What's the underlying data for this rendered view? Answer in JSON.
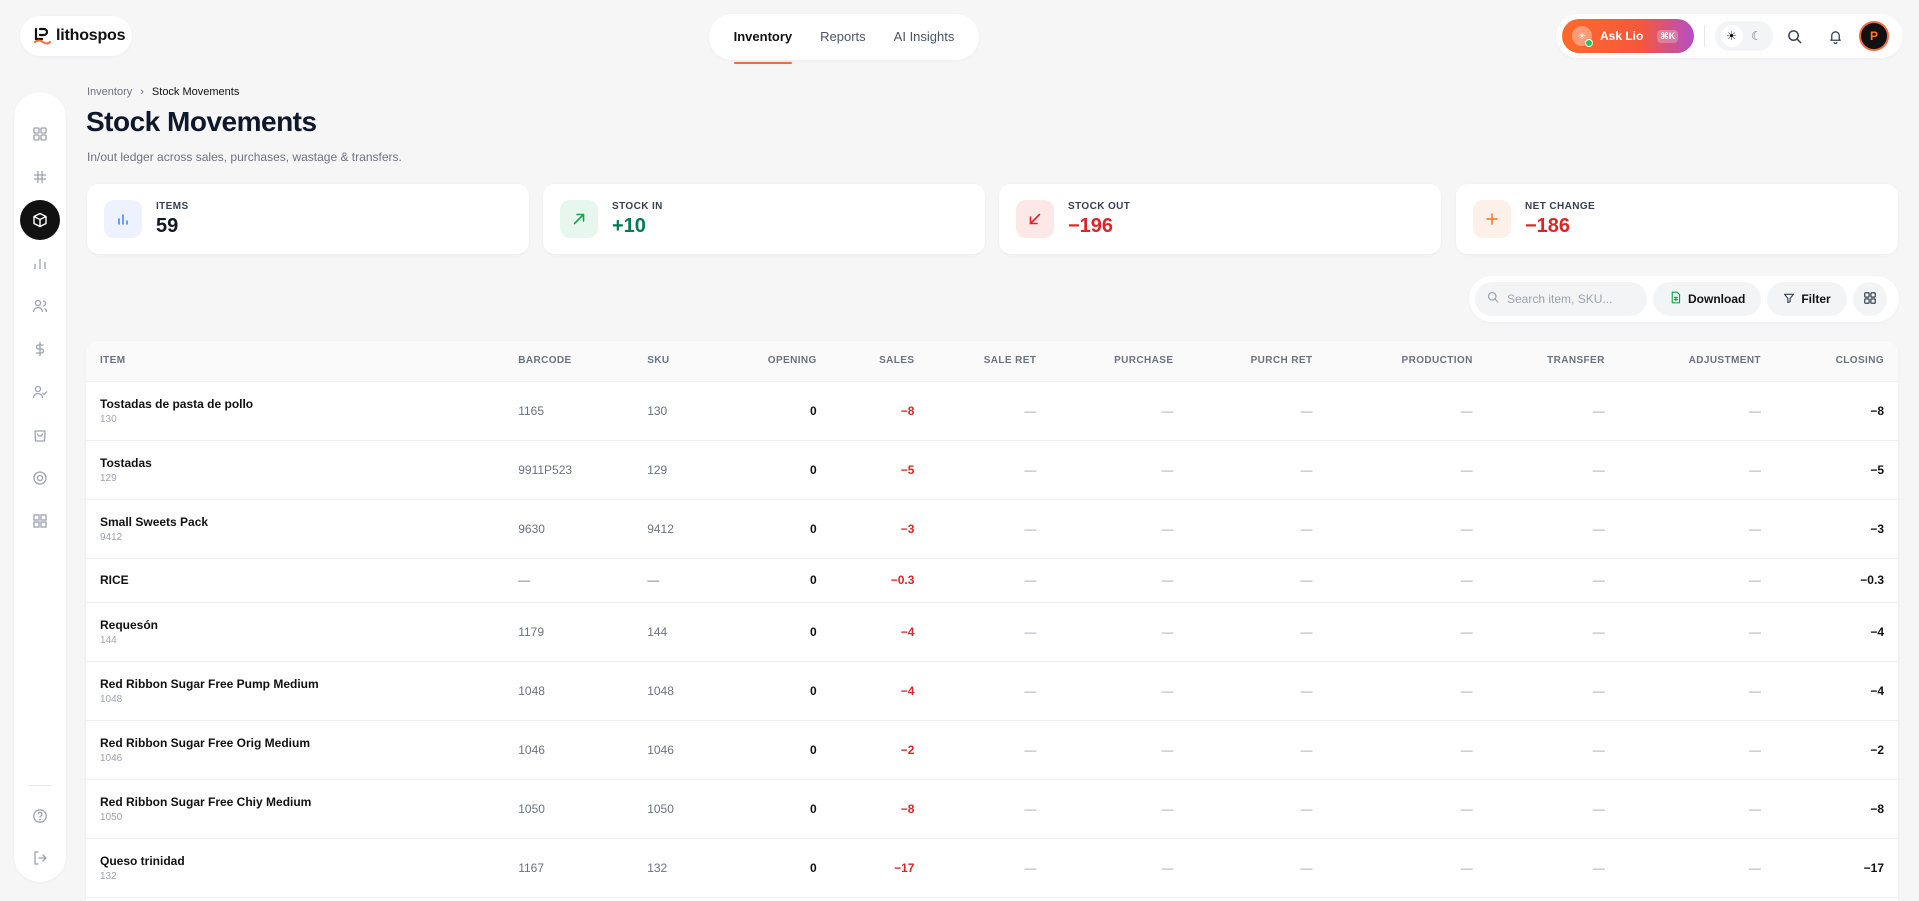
{
  "brand": {
    "name": "lithospos"
  },
  "nav": {
    "tabs": [
      "Inventory",
      "Reports",
      "AI Insights"
    ],
    "active": "Inventory"
  },
  "header": {
    "ask_label": "Ask Lio",
    "ask_shortcut": "⌘K",
    "avatar_initial": "P"
  },
  "breadcrumb": {
    "parent": "Inventory",
    "separator": "›",
    "current": "Stock Movements"
  },
  "page": {
    "title": "Stock Movements",
    "subtitle": "In/out ledger across sales, purchases, wastage & transfers."
  },
  "stats": [
    {
      "label": "ITEMS",
      "value": "59",
      "color": "#111827",
      "icon_bg": "#eef2ff",
      "icon_color": "#3b82f6",
      "icon": "bar-chart-icon"
    },
    {
      "label": "STOCK IN",
      "value": "+10",
      "color": "#047857",
      "icon_bg": "#e7f7ee",
      "icon_color": "#16a34a",
      "icon": "arrow-up-right-icon"
    },
    {
      "label": "STOCK OUT",
      "value": "−196",
      "color": "#dc2626",
      "icon_bg": "#fde8e8",
      "icon_color": "#dc2626",
      "icon": "arrow-down-left-icon"
    },
    {
      "label": "NET CHANGE",
      "value": "−186",
      "color": "#dc2626",
      "icon_bg": "#fdf0e8",
      "icon_color": "#f97316",
      "icon": "plus-icon"
    }
  ],
  "toolbar": {
    "search_placeholder": "Search item, SKU...",
    "download_label": "Download",
    "filter_label": "Filter"
  },
  "table": {
    "columns": [
      "ITEM",
      "BARCODE",
      "SKU",
      "OPENING",
      "SALES",
      "SALE RET",
      "PURCHASE",
      "PURCH RET",
      "PRODUCTION",
      "TRANSFER",
      "ADJUSTMENT",
      "CLOSING"
    ],
    "dash": "—",
    "rows": [
      {
        "name": "Tostadas de pasta de pollo",
        "sub": "130",
        "barcode": "1165",
        "sku": "130",
        "opening": "0",
        "sales": "−8",
        "closing": "−8"
      },
      {
        "name": "Tostadas",
        "sub": "129",
        "barcode": "9911P523",
        "sku": "129",
        "opening": "0",
        "sales": "−5",
        "closing": "−5"
      },
      {
        "name": "Small Sweets Pack",
        "sub": "9412",
        "barcode": "9630",
        "sku": "9412",
        "opening": "0",
        "sales": "−3",
        "closing": "−3"
      },
      {
        "name": "RICE",
        "sub": "",
        "barcode": "—",
        "sku": "—",
        "opening": "0",
        "sales": "−0.3",
        "closing": "−0.3"
      },
      {
        "name": "Requesón",
        "sub": "144",
        "barcode": "1179",
        "sku": "144",
        "opening": "0",
        "sales": "−4",
        "closing": "−4"
      },
      {
        "name": "Red Ribbon Sugar Free Pump Medium",
        "sub": "1048",
        "barcode": "1048",
        "sku": "1048",
        "opening": "0",
        "sales": "−4",
        "closing": "−4"
      },
      {
        "name": "Red Ribbon Sugar Free Orig Medium",
        "sub": "1046",
        "barcode": "1046",
        "sku": "1046",
        "opening": "0",
        "sales": "−2",
        "closing": "−2"
      },
      {
        "name": "Red Ribbon Sugar Free Chiy Medium",
        "sub": "1050",
        "barcode": "1050",
        "sku": "1050",
        "opening": "0",
        "sales": "−8",
        "closing": "−8"
      },
      {
        "name": "Queso trinidad",
        "sub": "132",
        "barcode": "1167",
        "sku": "132",
        "opening": "0",
        "sales": "−17",
        "closing": "−17"
      }
    ]
  },
  "sidebar": {
    "icons": [
      "dashboard-icon",
      "hashtag-icon",
      "inventory-box-icon",
      "analytics-icon",
      "customers-icon",
      "dollar-icon",
      "staff-icon",
      "shopping-bag-icon",
      "settings-icon",
      "apps-icon",
      "help-icon",
      "logout-icon"
    ],
    "active": "inventory-box-icon"
  }
}
